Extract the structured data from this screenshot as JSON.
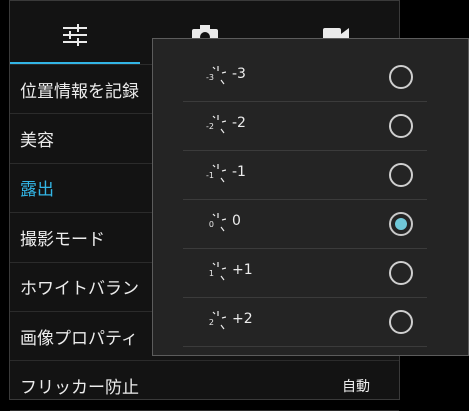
{
  "tabs": [
    {
      "icon": "sliders-icon",
      "selected": true
    },
    {
      "icon": "camera-icon",
      "selected": false
    },
    {
      "icon": "video-camera-icon",
      "selected": false
    }
  ],
  "menu": [
    {
      "label": "位置情報を記録",
      "value": ""
    },
    {
      "label": "美容",
      "value": ""
    },
    {
      "label": "露出",
      "value": "",
      "active": true
    },
    {
      "label": "撮影モード",
      "value": ""
    },
    {
      "label": "ホワイトバラン",
      "value": ""
    },
    {
      "label": "画像プロパティ",
      "value": ""
    },
    {
      "label": "フリッカー防止",
      "value": "自動"
    }
  ],
  "exposure_options": [
    {
      "icon_text": "-3",
      "label": "-3",
      "selected": false
    },
    {
      "icon_text": "-2",
      "label": "-2",
      "selected": false
    },
    {
      "icon_text": "-1",
      "label": "-1",
      "selected": false
    },
    {
      "icon_text": "0",
      "label": "0",
      "selected": true
    },
    {
      "icon_text": "1",
      "label": "+1",
      "selected": false
    },
    {
      "icon_text": "2",
      "label": "+2",
      "selected": false
    }
  ],
  "colors": {
    "accent": "#33b5e5",
    "radio_fill": "#70c8d8",
    "panel_bg": "#131313",
    "popup_bg": "#242424"
  }
}
